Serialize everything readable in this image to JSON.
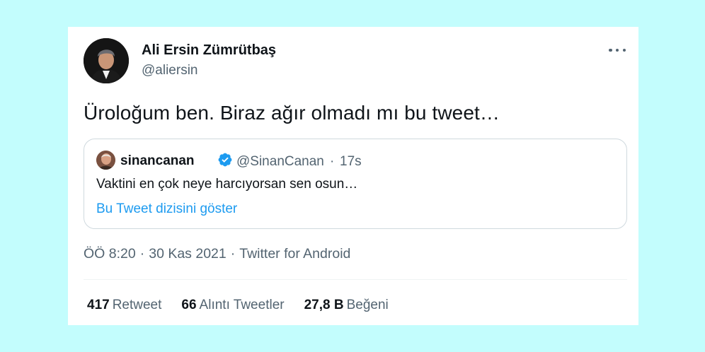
{
  "tweet": {
    "author": {
      "name": "Ali Ersin Zümrütbaş",
      "handle": "@aliersin",
      "avatar_icon": "profile-photo"
    },
    "text": "Üroloğum ben. Biraz ağır olmadı mı bu tweet…",
    "more_icon": "ellipsis-icon",
    "quoted": {
      "name": "sinancanan",
      "verified_icon": "verified-badge-icon",
      "handle": "@SinanCanan",
      "separator": "·",
      "time": "17s",
      "text": "Vaktini en çok neye harcıyorsan sen osun…",
      "thread_link": "Bu Tweet dizisini göster"
    },
    "meta": {
      "time": "ÖÖ 8:20",
      "separator": "·",
      "date": "30 Kas 2021",
      "source": "Twitter for Android"
    },
    "stats": [
      {
        "value": "417",
        "label": "Retweet"
      },
      {
        "value": "66",
        "label": "Alıntı Tweetler"
      },
      {
        "value": "27,8 B",
        "label": "Beğeni"
      }
    ]
  },
  "colors": {
    "background": "#c3fdfd",
    "card": "#ffffff",
    "text_primary": "#0f1419",
    "text_secondary": "#536471",
    "link": "#1d9bf0",
    "verified": "#1d9bf0"
  }
}
